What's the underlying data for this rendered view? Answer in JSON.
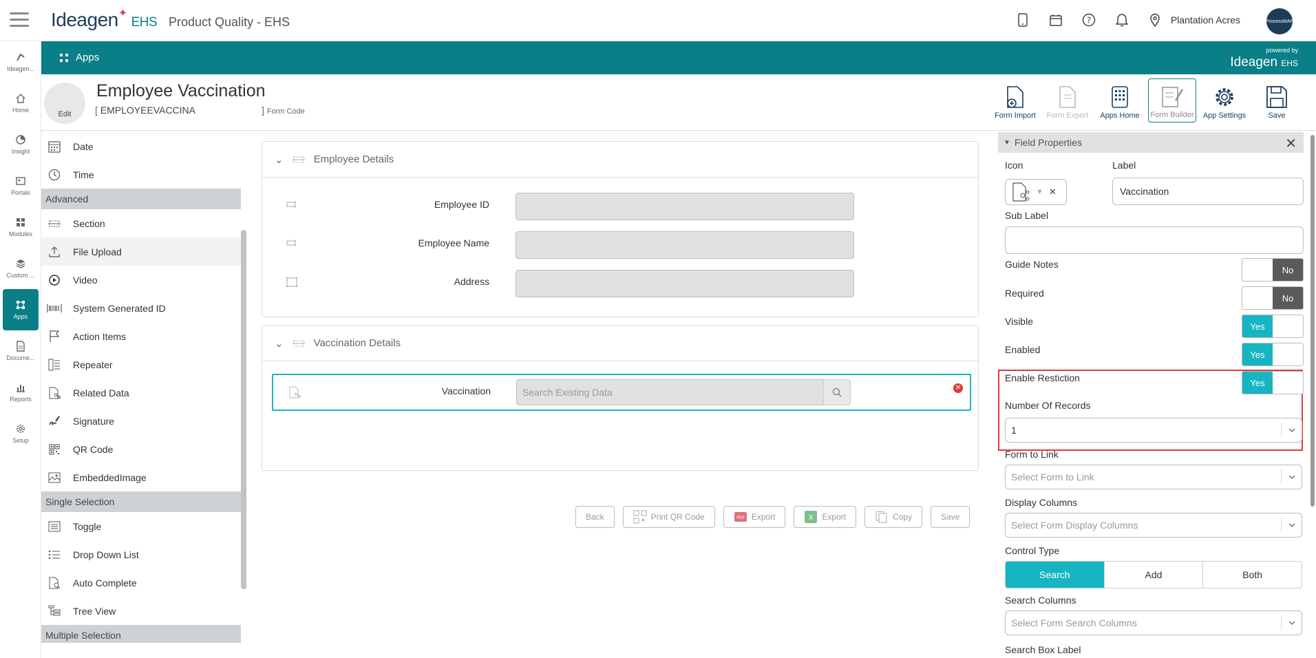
{
  "topbar": {
    "logo_text": "Ideagen",
    "logo_suffix": "EHS",
    "app_title": "Product Quality - EHS",
    "location": "Plantation Acres",
    "avatar_text": "ProcessMAP"
  },
  "leftnav": [
    {
      "name": "ideagen",
      "label": "Ideagen..."
    },
    {
      "name": "home",
      "label": "Home"
    },
    {
      "name": "insight",
      "label": "Insight"
    },
    {
      "name": "portals",
      "label": "Portals"
    },
    {
      "name": "modules",
      "label": "Modules"
    },
    {
      "name": "custom",
      "label": "Custom ..."
    },
    {
      "name": "apps",
      "label": "Apps"
    },
    {
      "name": "documents",
      "label": "Docume..."
    },
    {
      "name": "reports",
      "label": "Reports"
    },
    {
      "name": "setup",
      "label": "Setup"
    }
  ],
  "tealbar": {
    "title": "Apps",
    "powered_by": "powered by",
    "powered_logo": "Ideagen",
    "powered_suffix": "EHS"
  },
  "form": {
    "edit_label": "Edit",
    "title": "Employee Vaccination",
    "code": "EMPLOYEEVACCINA",
    "code_label": "Form Code"
  },
  "toolbar": {
    "form_import": "Form Import",
    "form_export": "Form Export",
    "apps_home": "Apps Home",
    "form_builder": "Form Builder",
    "app_settings": "App Settings",
    "save": "Save"
  },
  "palette": {
    "items_top": [
      "Date",
      "Time"
    ],
    "advanced_header": "Advanced",
    "advanced": [
      "Section",
      "File Upload",
      "Video",
      "System Generated ID",
      "Action Items",
      "Repeater",
      "Related Data",
      "Signature",
      "QR Code",
      "EmbeddedImage"
    ],
    "single_header": "Single Selection",
    "single": [
      "Toggle",
      "Drop Down List",
      "Auto Complete",
      "Tree View"
    ],
    "multiple_header": "Multiple Selection"
  },
  "canvas": {
    "section1_title": "Employee Details",
    "section1_fields": [
      "Employee ID",
      "Employee Name",
      "Address"
    ],
    "section2_title": "Vaccination Details",
    "vaccination_label": "Vaccination",
    "vaccination_placeholder": "Search Existing Data",
    "actions": {
      "back": "Back",
      "print_qr": "Print QR Code",
      "export_pdf": "Export",
      "export_xls": "Export",
      "copy": "Copy",
      "save": "Save"
    }
  },
  "props": {
    "title": "Field Properties",
    "icon_label": "Icon",
    "label_label": "Label",
    "label_value": "Vaccination",
    "sub_label": "Sub Label",
    "guide_notes": "Guide Notes",
    "guide_notes_value": "No",
    "required": "Required",
    "required_value": "No",
    "visible": "Visible",
    "visible_value": "Yes",
    "enabled": "Enabled",
    "enabled_value": "Yes",
    "enable_restriction": "Enable Restiction",
    "enable_restriction_value": "Yes",
    "number_of_records": "Number Of Records",
    "number_of_records_value": "1",
    "form_to_link": "Form to Link",
    "form_to_link_placeholder": "Select Form to Link",
    "display_columns": "Display Columns",
    "display_columns_placeholder": "Select Form Display Columns",
    "control_type": "Control Type",
    "control_options": [
      "Search",
      "Add",
      "Both"
    ],
    "control_selected": "Search",
    "search_columns": "Search Columns",
    "search_columns_placeholder": "Select Form Search Columns",
    "search_box_label": "Search Box Label"
  },
  "colors": {
    "teal": "#0a7f87",
    "accent": "#17b5c2",
    "highlight": "#e03a3a"
  }
}
